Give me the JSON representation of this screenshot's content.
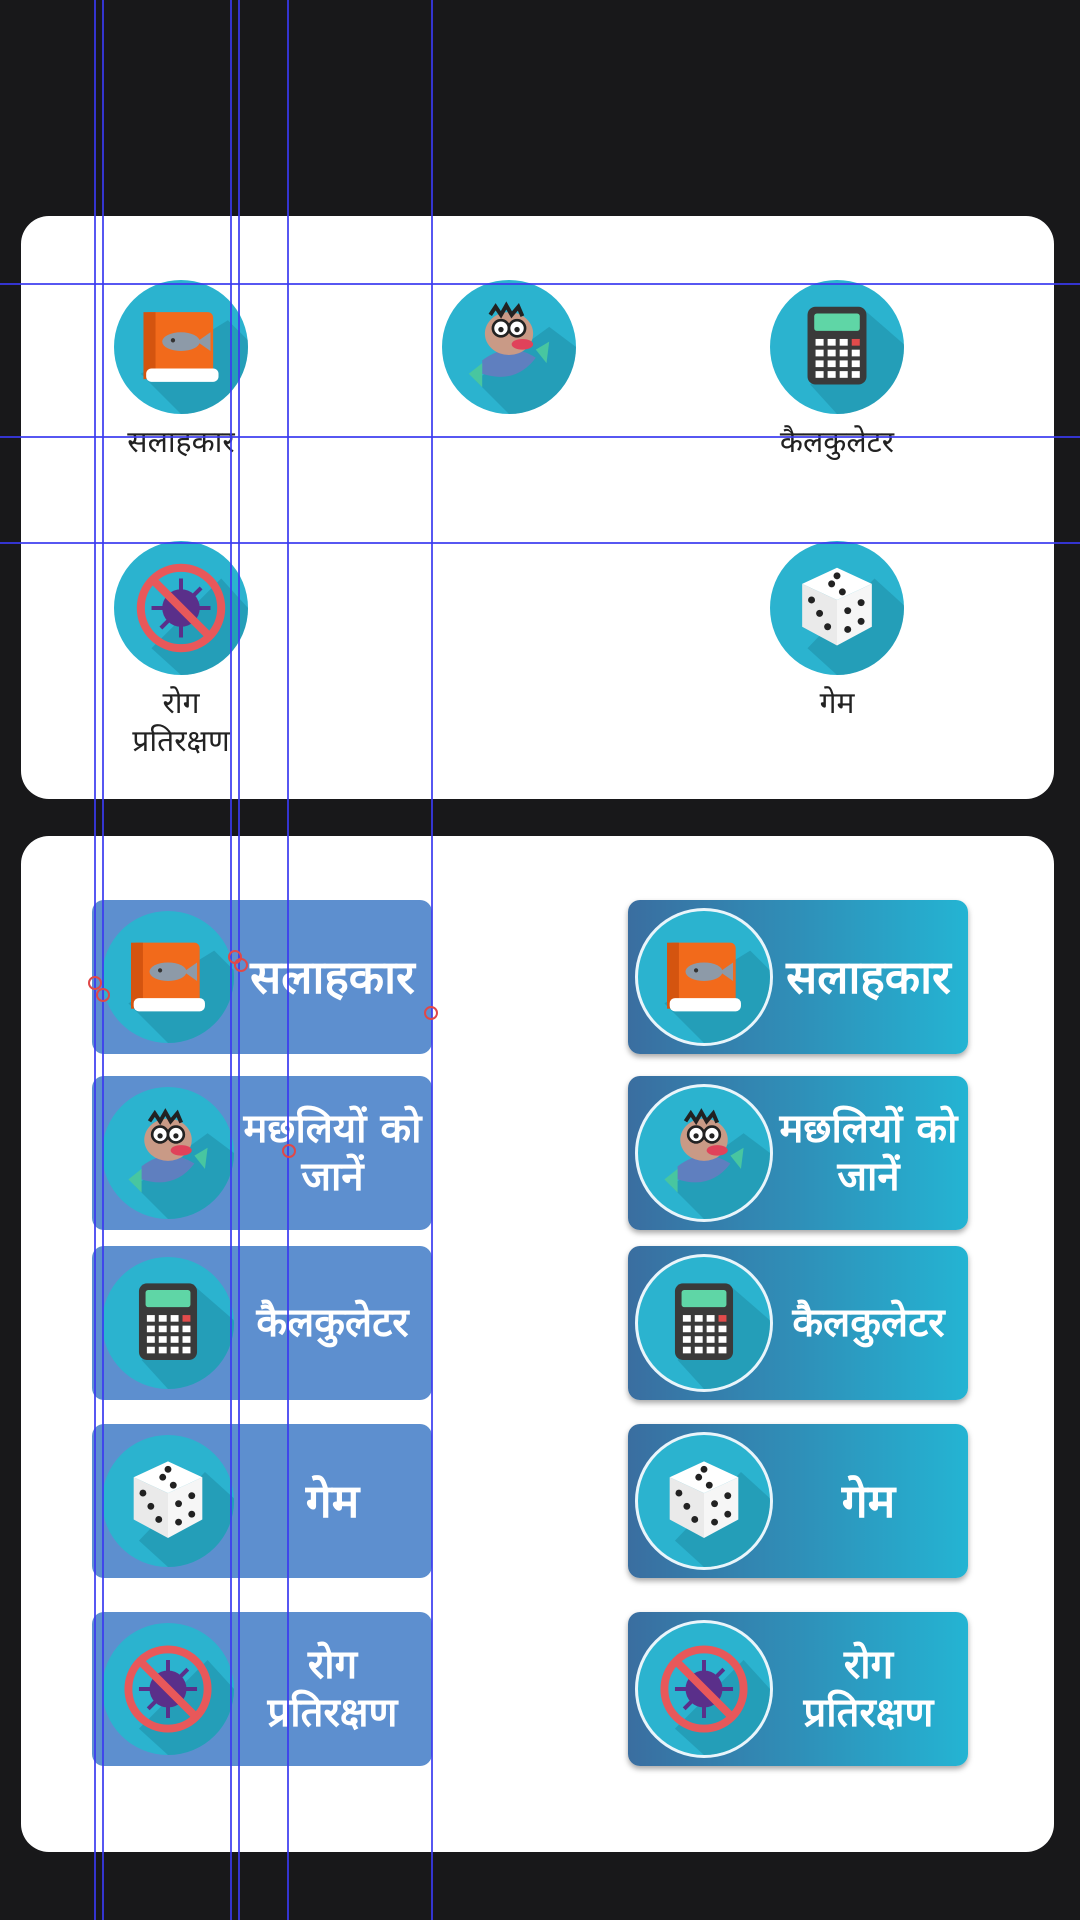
{
  "colors": {
    "background": "#18181a",
    "card": "#ffffff",
    "icon_circle": "#2bb3cf",
    "flat_button": "#5d8fcf",
    "gradient_start": "#3a6ea0",
    "gradient_end": "#24b4d3",
    "guide_line": "#3a3af0",
    "handle": "#e04848"
  },
  "grid_menu": {
    "items": [
      {
        "label": "सलाहकार",
        "icon": "fish-book-icon"
      },
      {
        "label": "",
        "icon": "fish-character-icon"
      },
      {
        "label": "कैलकुलेटर",
        "icon": "calculator-icon"
      },
      {
        "label": "रोग प्रतिरक्षण",
        "icon": "virus-prohibited-icon"
      },
      {
        "label": "गेम",
        "icon": "dice-icon"
      }
    ]
  },
  "flat_buttons": {
    "items": [
      {
        "label": "सलाहकार",
        "icon": "fish-book-icon"
      },
      {
        "label": "मछलियों को जानें",
        "icon": "fish-character-icon"
      },
      {
        "label": "कैलकुलेटर",
        "icon": "calculator-icon"
      },
      {
        "label": "गेम",
        "icon": "dice-icon"
      },
      {
        "label": "रोग प्रतिरक्षण",
        "icon": "virus-prohibited-icon"
      }
    ]
  },
  "gradient_buttons": {
    "items": [
      {
        "label": "सलाहकार",
        "icon": "fish-book-icon"
      },
      {
        "label": "मछलियों को जानें",
        "icon": "fish-character-icon"
      },
      {
        "label": "कैलकुलेटर",
        "icon": "calculator-icon"
      },
      {
        "label": "गेम",
        "icon": "dice-icon"
      },
      {
        "label": "रोग प्रतिरक्षण",
        "icon": "virus-prohibited-icon"
      }
    ]
  }
}
